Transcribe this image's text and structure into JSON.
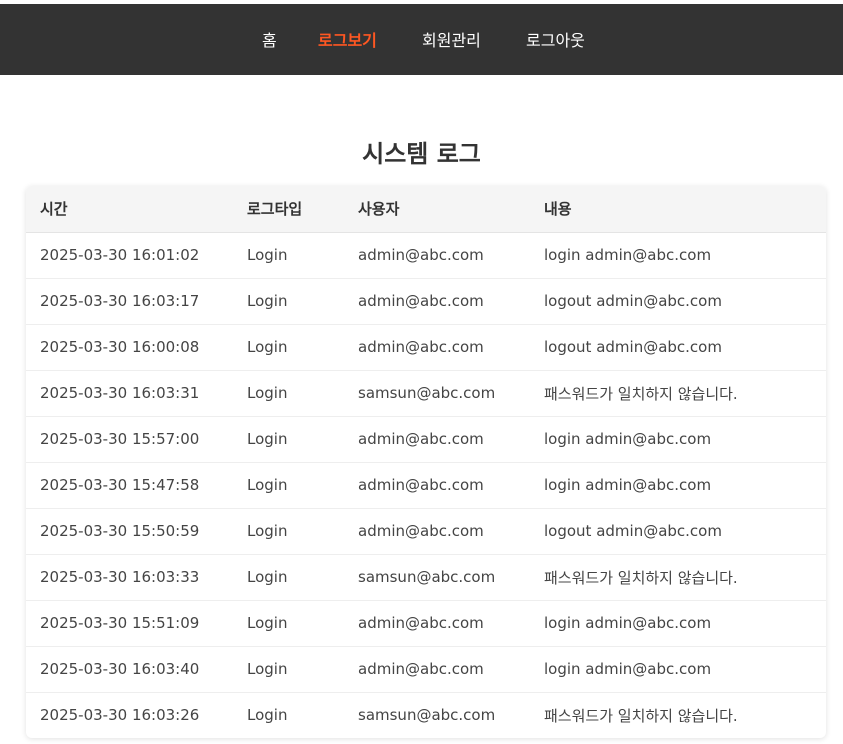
{
  "nav": {
    "items": [
      {
        "label": "홈",
        "active": false
      },
      {
        "label": "로그보기",
        "active": true
      },
      {
        "label": "회원관리",
        "active": false
      },
      {
        "label": "로그아웃",
        "active": false
      }
    ],
    "accent_color": "#ff5722",
    "bar_color": "#333333"
  },
  "page": {
    "title": "시스템 로그"
  },
  "table": {
    "columns": [
      "시간",
      "로그타입",
      "사용자",
      "내용"
    ],
    "rows": [
      {
        "time": "2025-03-30 16:01:02",
        "type": "Login",
        "user": "admin@abc.com",
        "message": "login admin@abc.com"
      },
      {
        "time": "2025-03-30 16:03:17",
        "type": "Login",
        "user": "admin@abc.com",
        "message": "logout admin@abc.com"
      },
      {
        "time": "2025-03-30 16:00:08",
        "type": "Login",
        "user": "admin@abc.com",
        "message": "logout admin@abc.com"
      },
      {
        "time": "2025-03-30 16:03:31",
        "type": "Login",
        "user": "samsun@abc.com",
        "message": "패스워드가 일치하지 않습니다."
      },
      {
        "time": "2025-03-30 15:57:00",
        "type": "Login",
        "user": "admin@abc.com",
        "message": "login admin@abc.com"
      },
      {
        "time": "2025-03-30 15:47:58",
        "type": "Login",
        "user": "admin@abc.com",
        "message": "login admin@abc.com"
      },
      {
        "time": "2025-03-30 15:50:59",
        "type": "Login",
        "user": "admin@abc.com",
        "message": "logout admin@abc.com"
      },
      {
        "time": "2025-03-30 16:03:33",
        "type": "Login",
        "user": "samsun@abc.com",
        "message": "패스워드가 일치하지 않습니다."
      },
      {
        "time": "2025-03-30 15:51:09",
        "type": "Login",
        "user": "admin@abc.com",
        "message": "login admin@abc.com"
      },
      {
        "time": "2025-03-30 16:03:40",
        "type": "Login",
        "user": "admin@abc.com",
        "message": "login admin@abc.com"
      },
      {
        "time": "2025-03-30 16:03:26",
        "type": "Login",
        "user": "samsun@abc.com",
        "message": "패스워드가 일치하지 않습니다."
      }
    ]
  }
}
